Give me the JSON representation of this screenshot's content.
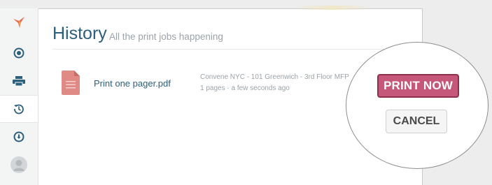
{
  "header": {
    "title": "History",
    "subtitle": "All the print jobs happening"
  },
  "sidebar": {
    "items": [
      {
        "icon": "logo-bird-icon"
      },
      {
        "icon": "target-icon"
      },
      {
        "icon": "printer-icon"
      },
      {
        "icon": "history-icon",
        "active": true
      },
      {
        "icon": "download-icon"
      },
      {
        "icon": "avatar-icon"
      }
    ]
  },
  "jobs": [
    {
      "file_name": "Print one pager.pdf",
      "printer": "Convene NYC - 101 Greenwich - 3rd Floor MFP",
      "meta": "1 pages · a few seconds ago",
      "file_icon": "pdf-file-icon"
    }
  ],
  "actions": {
    "print_label": "PRINT NOW",
    "cancel_label": "CANCEL"
  },
  "colors": {
    "accent": "#2c5f7c",
    "print_button": "#c5577a",
    "file_icon": "#e08a86",
    "logo": "#e86b4a"
  }
}
